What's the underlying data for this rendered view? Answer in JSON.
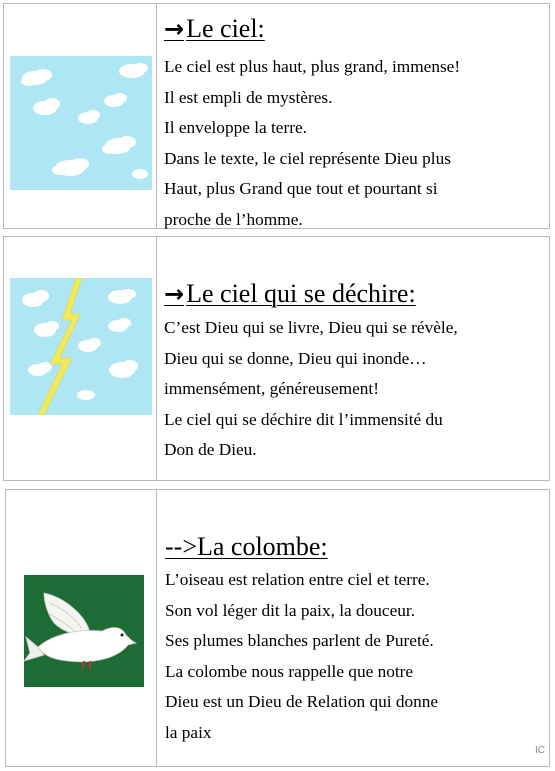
{
  "cards": [
    {
      "title": "Le ciel:",
      "arrow": "→",
      "image": "sky-with-clouds",
      "lines": [
        "Le ciel est plus haut, plus grand, immense!",
        "Il est empli de mystères.",
        "Il enveloppe la terre.",
        "Dans le texte, le ciel représente Dieu plus",
        "Haut, plus Grand que tout et pourtant si",
        "proche de l’homme."
      ]
    },
    {
      "title": "Le ciel qui se déchire:",
      "arrow": "→",
      "image": "sky-with-lightning",
      "lines": [
        "C’est Dieu qui se livre, Dieu qui se révèle,",
        "Dieu qui se donne, Dieu qui inonde…",
        "immensément, généreusement!",
        "Le ciel qui se déchire dit l’immensité du",
        "Don de Dieu."
      ]
    },
    {
      "title": "-->La colombe:",
      "image": "white-dove-on-green",
      "lines": [
        "L’oiseau est relation entre ciel et terre.",
        "Son vol léger dit la paix, la douceur.",
        "Ses plumes  blanches parlent de Pureté.",
        "La colombe nous rappelle que notre",
        "Dieu est un Dieu de Relation qui donne",
        "la paix"
      ]
    }
  ],
  "footer_mark": "IC",
  "colors": {
    "sky": "#aee7f3",
    "cloud": "#ffffff",
    "lightning": "#f2ea5a",
    "grass": "#1d6b35",
    "border": "#b8b8b8"
  }
}
